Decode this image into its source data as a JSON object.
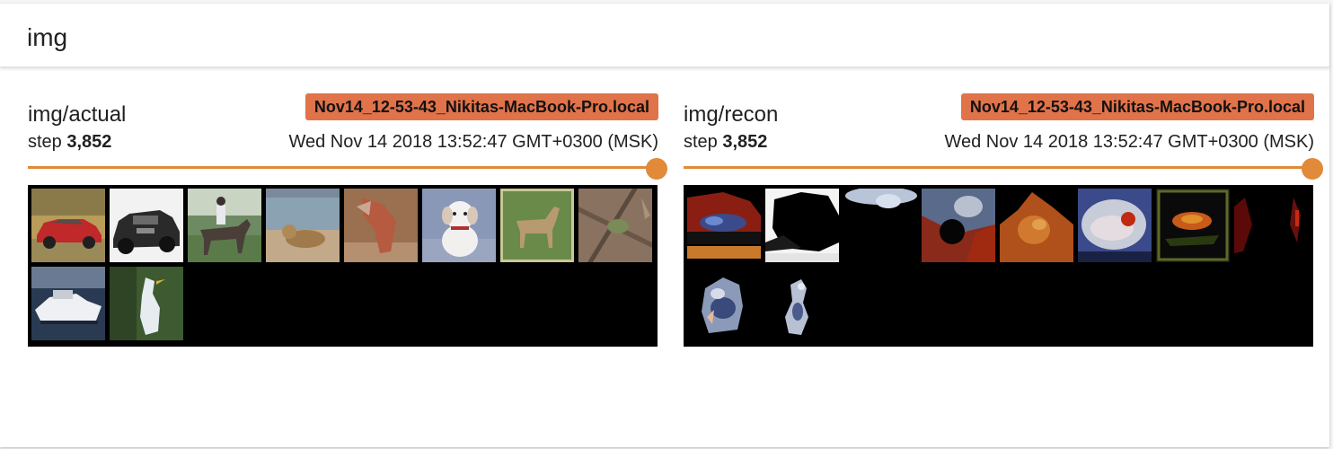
{
  "group": {
    "title": "img"
  },
  "cards": [
    {
      "tag": "img/actual",
      "step_label": "step",
      "step_value": "3,852",
      "run": "Nov14_12-53-43_Nikitas-MacBook-Pro.local",
      "wall_time": "Wed Nov 14 2018 13:52:47 GMT+0300 (MSK)"
    },
    {
      "tag": "img/recon",
      "step_label": "step",
      "step_value": "3,852",
      "run": "Nov14_12-53-43_Nikitas-MacBook-Pro.local",
      "wall_time": "Wed Nov 14 2018 13:52:47 GMT+0300 (MSK)"
    }
  ],
  "colors": {
    "accent": "#e08a3a",
    "run_badge": "#e0734a",
    "image_background": "#000000"
  }
}
